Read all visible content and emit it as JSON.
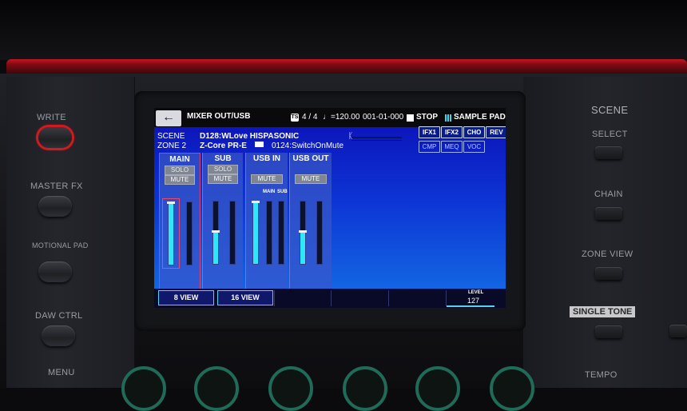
{
  "device": {
    "left_labels": [
      "WRITE",
      "MASTER FX",
      "MOTIONAL PAD",
      "DAW CTRL",
      "MENU"
    ],
    "right": {
      "scene_title": "SCENE",
      "select": "SELECT",
      "chain": "CHAIN",
      "zone_view": "ZONE VIEW",
      "single_tone": "SINGLE TONE",
      "tempo": "TEMPO"
    }
  },
  "screen": {
    "header": {
      "back_icon": "arrow-left",
      "title": "MIXER OUT/USB",
      "time_signature": "4 / 4",
      "tempo": "♩=120.00",
      "position": "001-01-000",
      "transport": "STOP",
      "sample_pad": "SAMPLE PAD"
    },
    "scene": {
      "label": "SCENE",
      "value": "D128:WLove HISPASONIC",
      "zone_label": "ZONE 2",
      "tone": "Z-Core PR-E",
      "tone_number": "0124:SwitchOnMute"
    },
    "effects": {
      "row1": [
        "IFX1",
        "IFX2",
        "CHO",
        "REV"
      ],
      "row2": [
        "CMP",
        "MEQ",
        "VOC"
      ]
    },
    "channels": [
      {
        "name": "MAIN",
        "solo": "SOLO",
        "mute": "MUTE",
        "levels": [
          1.0,
          0.0
        ]
      },
      {
        "name": "SUB",
        "solo": "SOLO",
        "mute": "MUTE",
        "levels": [
          0.52,
          0.0
        ]
      },
      {
        "name": "USB IN",
        "solo": "",
        "mute": "MUTE",
        "sublabels": [
          "MAIN",
          "SUB"
        ],
        "levels": [
          1.0,
          0.0,
          0.0
        ]
      },
      {
        "name": "USB OUT",
        "solo": "",
        "mute": "MUTE",
        "levels": [
          0.52,
          0.0
        ]
      }
    ],
    "bottom": {
      "view8": "8 VIEW",
      "view16": "16 VIEW",
      "level_label": "LEVEL",
      "level_value": "127"
    }
  }
}
